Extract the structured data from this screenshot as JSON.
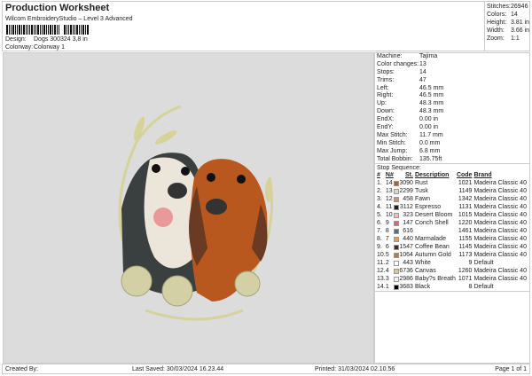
{
  "header": {
    "title": "Production Worksheet",
    "subtitle": "Wilcom EmbroideryStudio – Level 3 Advanced",
    "design_label": "Design:",
    "design_value": "Dogs 300324 3,8 in",
    "colorway_label": "Colorway:",
    "colorway_value": "Colorway 1"
  },
  "stats": [
    {
      "label": "Stitches:",
      "value": "26946"
    },
    {
      "label": "Colors:",
      "value": "14"
    },
    {
      "label": "Height:",
      "value": "3.81 in"
    },
    {
      "label": "Width:",
      "value": "3.66 in"
    },
    {
      "label": "Zoom:",
      "value": "1:1"
    }
  ],
  "details": [
    {
      "label": "Machine:",
      "value": "Tajima"
    },
    {
      "label": "Color changes:",
      "value": "13"
    },
    {
      "label": "Stops:",
      "value": "14"
    },
    {
      "label": "Trims:",
      "value": "47"
    },
    {
      "label": "Left:",
      "value": "46.5 mm"
    },
    {
      "label": "Right:",
      "value": "46.5 mm"
    },
    {
      "label": "Up:",
      "value": "48.3 mm"
    },
    {
      "label": "Down:",
      "value": "48.3 mm"
    },
    {
      "label": "EndX:",
      "value": "0.00 in"
    },
    {
      "label": "EndY:",
      "value": "0.00 in"
    },
    {
      "label": "Max Stitch:",
      "value": "11.7 mm"
    },
    {
      "label": "Min Stitch:",
      "value": "0.0 mm"
    },
    {
      "label": "Max Jump:",
      "value": "6.8 mm"
    },
    {
      "label": "Total Bobbin:",
      "value": "135.75ft"
    }
  ],
  "sequence": {
    "title": "Stop Sequence:",
    "headers": [
      "#",
      "N#",
      "St.",
      "Description",
      "Code",
      "Brand"
    ],
    "rows": [
      [
        "1.",
        "14",
        "#c0562a",
        "3090",
        "Rust",
        "1021",
        "Madeira Classic 40"
      ],
      [
        "2.",
        "13",
        "#e6d6bc",
        "2299",
        "Tusk",
        "1149",
        "Madeira Classic 40"
      ],
      [
        "3.",
        "12",
        "#c4957c",
        "458",
        "Fawn",
        "1342",
        "Madeira Classic 40"
      ],
      [
        "4.",
        "11",
        "#1e1e1e",
        "3112",
        "Espresso",
        "1131",
        "Madeira Classic 40"
      ],
      [
        "5.",
        "10",
        "#f2bcbc",
        "323",
        "Desert Bloom",
        "1015",
        "Madeira Classic 40"
      ],
      [
        "6.",
        "9",
        "#e06868",
        "147",
        "Conch Shell",
        "1220",
        "Madeira Classic 40"
      ],
      [
        "7.",
        "8",
        "#5c6c72",
        "616",
        "",
        "1461",
        "Madeira Classic 40"
      ],
      [
        "8.",
        "7",
        "#f29a52",
        "440",
        "Marmalade",
        "1155",
        "Madeira Classic 40"
      ],
      [
        "9.",
        "6",
        "#4a2a20",
        "1547",
        "Coffee Bean",
        "1145",
        "Madeira Classic 40"
      ],
      [
        "10.",
        "5",
        "#c27a2c",
        "1064",
        "Autumn Gold",
        "1173",
        "Madeira Classic 40"
      ],
      [
        "11.",
        "2",
        "#ffffff",
        "443",
        "White",
        "9",
        "Default"
      ],
      [
        "12.",
        "4",
        "#d8c890",
        "6736",
        "Canvas",
        "1260",
        "Madeira Classic 40"
      ],
      [
        "13.",
        "3",
        "#f6f6ee",
        "2986",
        "Baby?s Breath",
        "1071",
        "Madeira Classic 40"
      ],
      [
        "14.",
        "1",
        "#000000",
        "3683",
        "Black",
        "8",
        "Default"
      ]
    ]
  },
  "footer": {
    "created": "Created By:",
    "saved": "Last Saved: 30/03/2024 16.23.44",
    "printed": "Printed: 31/03/2024 02.10.56",
    "page": "Page 1 of 1"
  }
}
